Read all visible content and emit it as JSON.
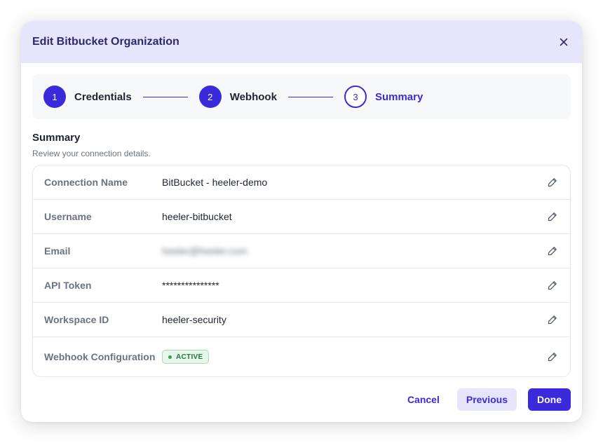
{
  "modal": {
    "title": "Edit Bitbucket Organization"
  },
  "stepper": {
    "steps": [
      {
        "number": "1",
        "label": "Credentials",
        "state": "done"
      },
      {
        "number": "2",
        "label": "Webhook",
        "state": "done"
      },
      {
        "number": "3",
        "label": "Summary",
        "state": "current"
      }
    ]
  },
  "summary": {
    "title": "Summary",
    "subtitle": "Review your connection details.",
    "rows": [
      {
        "label": "Connection Name",
        "value": "BitBucket - heeler-demo"
      },
      {
        "label": "Username",
        "value": "heeler-bitbucket"
      },
      {
        "label": "Email",
        "value": "heeler@heeler.com"
      },
      {
        "label": "API Token",
        "value": "***************"
      },
      {
        "label": "Workspace ID",
        "value": "heeler-security"
      },
      {
        "label": "Webhook Configuration",
        "value": "ACTIVE"
      }
    ]
  },
  "footer": {
    "cancel_label": "Cancel",
    "previous_label": "Previous",
    "done_label": "Done"
  },
  "colors": {
    "accent": "#3b2adb",
    "header_bg": "#e7e5fb",
    "badge_bg": "#e6f6ea",
    "badge_text": "#1f7a3a"
  },
  "icons": {
    "close": "close-icon",
    "edit": "pencil-icon",
    "status": "dot-icon"
  }
}
